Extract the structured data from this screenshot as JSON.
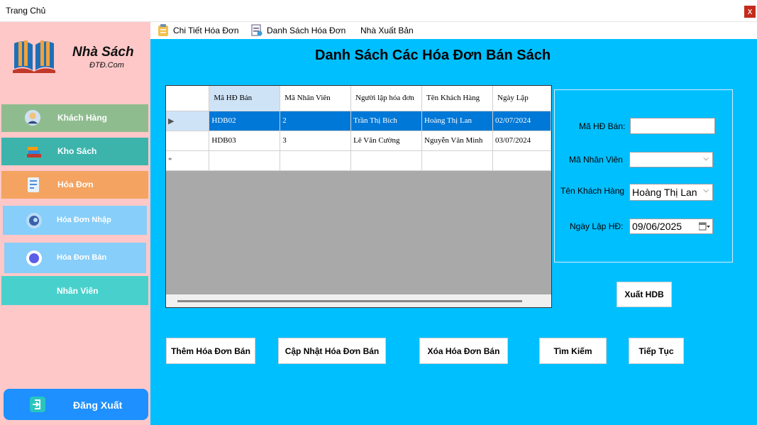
{
  "window": {
    "title": "Trang Chủ",
    "close_glyph": "x"
  },
  "brand": {
    "name": "Nhà Sách",
    "subtitle": "ĐTĐ.Com"
  },
  "sidebar": {
    "items": [
      {
        "label": "Khách Hàng",
        "icon": "customer-icon",
        "color": "#8fbc8f"
      },
      {
        "label": "Kho Sách",
        "icon": "books-icon",
        "color": "#3cb4ac"
      },
      {
        "label": "Hóa Đơn",
        "icon": "invoice-icon",
        "color": "#f4a460"
      },
      {
        "label": "Hóa Đơn Nhập",
        "icon": "import-invoice-icon",
        "color": "#87cefa"
      },
      {
        "label": "Hóa Đơn Bán",
        "icon": "sales-invoice-icon",
        "color": "#87cefa"
      },
      {
        "label": "Nhân Viên",
        "icon": "",
        "color": "#48d1cc"
      }
    ],
    "logout": {
      "label": "Đăng Xuất",
      "icon": "logout-icon",
      "color": "#1e90ff"
    }
  },
  "menubar": {
    "items": [
      {
        "label": "Chi Tiết Hóa Đơn",
        "icon": "clipboard-icon"
      },
      {
        "label": "Danh Sách Hóa Đơn",
        "icon": "document-list-icon"
      },
      {
        "label": "Nhà Xuất Bản",
        "icon": ""
      }
    ]
  },
  "main": {
    "heading": "Danh Sách Các Hóa Đơn Bán Sách",
    "background": "#00bfff"
  },
  "grid": {
    "columns": [
      "Mã HĐ Bán",
      "Mã Nhân Viên",
      "Người lập hóa đơn",
      "Tên Khách Hàng",
      "Ngày Lập"
    ],
    "rows": [
      {
        "marker": "▶",
        "cells": [
          "HDB02",
          "2",
          "Trần Thị Bích",
          "Hoàng Thị Lan",
          "02/07/2024"
        ]
      },
      {
        "marker": "",
        "cells": [
          "HDB03",
          "3",
          "Lê Văn Cường",
          "Nguyễn Văn Minh",
          "03/07/2024"
        ]
      }
    ],
    "new_row_marker": "*"
  },
  "form": {
    "ma_hd_ban": {
      "label": "Mã HĐ Bán:",
      "value": ""
    },
    "ma_nhan_vien": {
      "label": "Mã Nhân Viên",
      "value": ""
    },
    "ten_khach_hang": {
      "label": "Tên Khách Hàng",
      "value": "Hoàng Thị Lan"
    },
    "ngay_lap": {
      "label": "Ngày Lập HĐ:",
      "value": "09/06/2025"
    }
  },
  "buttons": {
    "export": "Xuất HDB",
    "add": "Thêm Hóa Đơn Bán",
    "update": "Cập Nhật Hóa Đơn Bán",
    "delete": "Xóa Hóa Đơn Bán",
    "search": "Tìm Kiếm",
    "continue": "Tiếp Tục"
  }
}
